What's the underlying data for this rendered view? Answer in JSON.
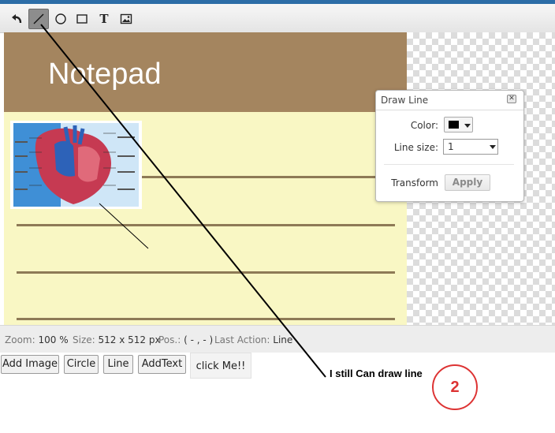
{
  "toolbar": {
    "tools": [
      {
        "icon": "undo-icon"
      },
      {
        "icon": "line-tool-icon",
        "active": true
      },
      {
        "icon": "circle-tool-icon"
      },
      {
        "icon": "rectangle-tool-icon"
      },
      {
        "icon": "text-tool-icon",
        "glyph": "T"
      },
      {
        "icon": "image-tool-icon"
      }
    ]
  },
  "canvas": {
    "header_text": "Notepad",
    "header_color": "#a4855f",
    "paper_color": "#f9f7c4"
  },
  "dialog": {
    "title": "Draw Line",
    "close_glyph": "✕",
    "color_label": "Color:",
    "color_value": "#000000",
    "line_size_label": "Line size:",
    "line_size_value": "1",
    "transform_label": "Transform",
    "apply_label": "Apply"
  },
  "status": {
    "zoom_label": "Zoom:",
    "zoom_value": "100 %",
    "size_label": "Size:",
    "size_value": "512 x 512 px",
    "pos_label": "Pos.:",
    "pos_value": "( - , - )",
    "last_action_label": "Last Action:",
    "last_action_value": "Line"
  },
  "buttons": {
    "add_image": "Add Image",
    "circle": "Circle",
    "line": "Line",
    "add_text": "AddText",
    "click_me": "click Me!!"
  },
  "annotation": {
    "note": "I still Can draw line",
    "number": "2",
    "number_color": "#dd3333"
  }
}
